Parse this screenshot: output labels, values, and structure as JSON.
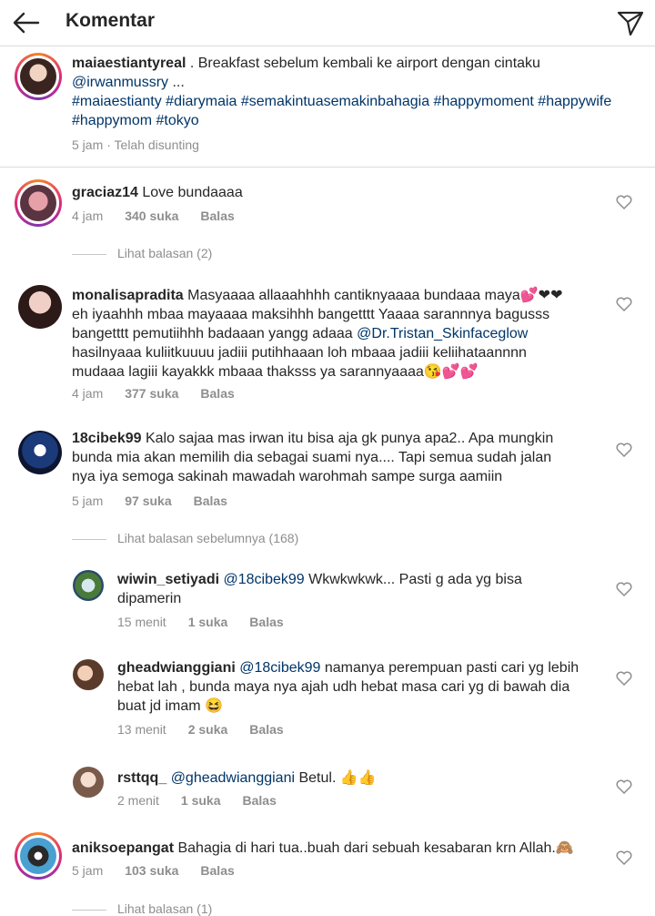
{
  "header": {
    "title": "Komentar"
  },
  "caption": {
    "username": "maiaestiantyreal",
    "text_before": " . Breakfast sebelum kembali ke airport dengan cintaku ",
    "mention": "@irwanmussry",
    "text_after": " ...",
    "hashtags": "#maiaestianty #diarymaia #semakintuasemakinbahagia #happymoment #happywife #happymom #tokyo",
    "time": "5 jam",
    "edited": "· Telah disunting"
  },
  "comments": [
    {
      "username": "graciaz14",
      "text": " Love bundaaaa",
      "time": "4 jam",
      "likes": "340 suka",
      "reply": "Balas",
      "view_replies": "Lihat balasan (2)"
    },
    {
      "username": "monalisapradita",
      "text1": " Masyaaaa allaaahhhh cantiknyaaaa bundaaa maya💕❤❤",
      "text2": "eh iyaahhh mbaa mayaaaa maksihhh bangetttt Yaaaa sarannnya bagusss",
      "text3": "bangetttt pemutiihhh badaaan yangg adaaa ",
      "mention": "@Dr.Tristan_Skinfaceglow",
      "text4": "hasilnyaaa kuliitkuuuu jadiii putihhaaan loh mbaaa jadiii keliihataannnn",
      "text5": "mudaaa lagiii kayakkk mbaaa thaksss ya sarannyaaaa😘💕💕",
      "time": "4 jam",
      "likes": "377 suka",
      "reply": "Balas"
    },
    {
      "username": "18cibek99",
      "text1": " Kalo sajaa mas irwan itu bisa aja gk punya apa2.. Apa mungkin",
      "text2": "bunda mia akan memilih dia sebagai suami nya.... Tapi semua sudah jalan",
      "text3": "nya iya semoga sakinah mawadah warohmah sampe surga aamiin",
      "time": "5 jam",
      "likes": "97 suka",
      "reply": "Balas",
      "view_previous": "Lihat balasan sebelumnya (168)"
    },
    {
      "username": "wiwin_setiyadi",
      "mention": "@18cibek99",
      "text1": " Wkwkwkwk... Pasti g ada yg bisa",
      "text2": "dipamerin",
      "time": "15 menit",
      "likes": "1 suka",
      "reply": "Balas"
    },
    {
      "username": "gheadwianggiani",
      "mention": "@18cibek99",
      "text1": " namanya perempuan pasti cari yg lebih",
      "text2": "hebat lah , bunda maya nya ajah udh hebat masa cari yg di bawah dia",
      "text3": "buat jd imam 😆",
      "time": "13 menit",
      "likes": "2 suka",
      "reply": "Balas"
    },
    {
      "username": "rsttqq_",
      "mention": "@gheadwianggiani",
      "text1": " Betul. 👍👍",
      "time": "2 menit",
      "likes": "1 suka",
      "reply": "Balas"
    },
    {
      "username": "aniksoepangat",
      "text1": " Bahagia di hari tua..buah dari sebuah kesabaran krn Allah.🙈",
      "time": "5 jam",
      "likes": "103 suka",
      "reply": "Balas",
      "view_replies": "Lihat balasan (1)"
    }
  ],
  "colors": {
    "link": "#003569",
    "meta": "#8e8e8e",
    "text": "#262626"
  }
}
